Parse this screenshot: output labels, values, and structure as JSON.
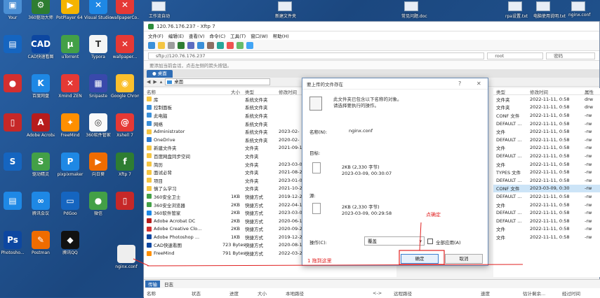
{
  "desktop": {
    "icons": [
      {
        "label": "Your",
        "color": "#4b8fd4",
        "glyph": "▣"
      },
      {
        "label": "360驱动大师",
        "color": "#2e7d32",
        "glyph": "⚙"
      },
      {
        "label": "PotPlayer 64 bit",
        "color": "#f5b400",
        "glyph": "▶"
      },
      {
        "label": "Visual Studio Code",
        "color": "#1e88e5",
        "glyph": "✕"
      },
      {
        "label": "wallpaperCo...",
        "color": "#e53935",
        "glyph": "✕"
      },
      {
        "label": "",
        "color": "#1565c0",
        "glyph": "▤"
      },
      {
        "label": "CAD快速看图",
        "color": "#0d47a1",
        "glyph": "CAD"
      },
      {
        "label": "uTorrent",
        "color": "#43a047",
        "glyph": "µ"
      },
      {
        "label": "Typora",
        "color": "#f5f5f5",
        "glyph": "T"
      },
      {
        "label": "wallpaper...",
        "color": "#e53935",
        "glyph": "✕"
      },
      {
        "label": "",
        "color": "#d32f2f",
        "glyph": "●"
      },
      {
        "label": "百度网盘",
        "color": "#1e88e5",
        "glyph": "K"
      },
      {
        "label": "Xmind ZEN",
        "color": "#e53935",
        "glyph": "✕"
      },
      {
        "label": "Snipaste",
        "color": "#3949ab",
        "glyph": "▦"
      },
      {
        "label": "Google Chrome",
        "color": "#fbc02d",
        "glyph": "◉"
      },
      {
        "label": "",
        "color": "#c62828",
        "glyph": "▯"
      },
      {
        "label": "Adobe Acrobat DC",
        "color": "#b71c1c",
        "glyph": "A"
      },
      {
        "label": "FreeMind",
        "color": "#ff8f00",
        "glyph": "✦"
      },
      {
        "label": "360软件管家",
        "color": "#fafafa",
        "glyph": "◎"
      },
      {
        "label": "Xshell 7",
        "color": "#e53935",
        "glyph": "@"
      },
      {
        "label": "",
        "color": "#1565c0",
        "glyph": "S"
      },
      {
        "label": "驱动精灵",
        "color": "#43a047",
        "glyph": "S"
      },
      {
        "label": "pixpixmaker",
        "color": "#1e88e5",
        "glyph": "P"
      },
      {
        "label": "向日葵",
        "color": "#ef6c00",
        "glyph": "▶"
      },
      {
        "label": "Xftp 7",
        "color": "#2e7d32",
        "glyph": "f"
      },
      {
        "label": "",
        "color": "#1e88e5",
        "glyph": "▤"
      },
      {
        "label": "腾讯会议",
        "color": "#1e88e5",
        "glyph": "∞"
      },
      {
        "label": "PdGoo",
        "color": "#1565c0",
        "glyph": "▭"
      },
      {
        "label": "微信",
        "color": "#43a047",
        "glyph": "●"
      },
      {
        "label": "",
        "color": "#c62828",
        "glyph": "▯"
      },
      {
        "label": "Photosho...",
        "color": "#0d47a1",
        "glyph": "Ps"
      },
      {
        "label": "Postman",
        "color": "#ef6c00",
        "glyph": "✎"
      },
      {
        "label": "腾讯QQ",
        "color": "#111111",
        "glyph": "◆"
      },
      {
        "label": "nginx.conf",
        "color": "#eeeeee",
        "glyph": ""
      }
    ],
    "top_items": [
      {
        "label": "工作流自动"
      },
      {
        "label": "新建文件夹"
      },
      {
        "label": "常见问题.doc"
      },
      {
        "label": "rpa设置.txt"
      },
      {
        "label": "电脑使用说明.txt"
      },
      {
        "label": "nginx.conf"
      }
    ]
  },
  "xftp": {
    "title": "120.76.176.237 - Xftp 7",
    "menu": [
      "文件(F)",
      "编辑(E)",
      "查看(V)",
      "命令(C)",
      "工具(T)",
      "窗口(W)",
      "帮助(H)"
    ],
    "address": "sftp://120.76.176.237",
    "remote_address": "root",
    "password_placeholder": "密码",
    "hint": "要添加当前会话，点击左侧的箭头按钮。",
    "tab_label": "● 桌面",
    "nav_path": "桌面",
    "columns": {
      "name": "名称",
      "size": "大小",
      "type": "类型",
      "date": "修改时间"
    },
    "local_files": [
      {
        "name": "库",
        "size": "",
        "type": "系统文件夹",
        "date": "",
        "color": "#f4c542"
      },
      {
        "name": "控制面板",
        "size": "",
        "type": "系统文件夹",
        "date": "",
        "color": "#3a8fd9"
      },
      {
        "name": "此电脑",
        "size": "",
        "type": "系统文件夹",
        "date": "",
        "color": "#3a8fd9"
      },
      {
        "name": "网络",
        "size": "",
        "type": "系统文件夹",
        "date": "",
        "color": "#3a8fd9"
      },
      {
        "name": "Administrator",
        "size": "",
        "type": "系统文件夹",
        "date": "2023-02-",
        "color": "#f4c542"
      },
      {
        "name": "OneDrive",
        "size": "",
        "type": "系统文件夹",
        "date": "2020-02-",
        "color": "#2b7cd3"
      },
      {
        "name": "新建文件夹",
        "size": "",
        "type": "文件夹",
        "date": "2021-09-1",
        "color": "#f4c542"
      },
      {
        "name": "百度网盘同步空间",
        "size": "",
        "type": "文件夹",
        "date": "",
        "color": "#f4c542"
      },
      {
        "name": "简历",
        "size": "",
        "type": "文件夹",
        "date": "2023-03-0",
        "color": "#f4c542"
      },
      {
        "name": "面试必背",
        "size": "",
        "type": "文件夹",
        "date": "2021-08-2",
        "color": "#f4c542"
      },
      {
        "name": "项目",
        "size": "",
        "type": "文件夹",
        "date": "2023-01-0",
        "color": "#f4c542"
      },
      {
        "name": "慎了么学习",
        "size": "",
        "type": "文件夹",
        "date": "2021-10-2",
        "color": "#f4c542"
      },
      {
        "name": "360安全卫士",
        "size": "1KB",
        "type": "快捷方式",
        "date": "2019-12-2",
        "color": "#43a047"
      },
      {
        "name": "360安全浏览器",
        "size": "2KB",
        "type": "快捷方式",
        "date": "2022-04-1",
        "color": "#43a047"
      },
      {
        "name": "360软件管家",
        "size": "2KB",
        "type": "快捷方式",
        "date": "2023-03-0",
        "color": "#1e88e5"
      },
      {
        "name": "Adobe Acrobat DC",
        "size": "2KB",
        "type": "快捷方式",
        "date": "2020-06-1",
        "color": "#b71c1c"
      },
      {
        "name": "Adobe Creative Clo...",
        "size": "2KB",
        "type": "快捷方式",
        "date": "2020-09-2",
        "color": "#d32f2f"
      },
      {
        "name": "Adobe Photoshop ...",
        "size": "1KB",
        "type": "快捷方式",
        "date": "2019-12-2",
        "color": "#0d47a1"
      },
      {
        "name": "CAD快速看图",
        "size": "723 Bytes",
        "type": "快捷方式",
        "date": "2020-08-1",
        "color": "#0d47a1"
      },
      {
        "name": "FreeMind",
        "size": "791 Bytes",
        "type": "快捷方式",
        "date": "2022-03-2",
        "color": "#ff8f00"
      }
    ],
    "remote_columns": {
      "type": "类型",
      "date": "修改时间",
      "attr": "属性"
    },
    "remote_files": [
      {
        "type": "文件夹",
        "date": "2022-11-11, 0:58",
        "attr": "drw"
      },
      {
        "type": "文件夹",
        "date": "2022-11-11, 0:58",
        "attr": "drw"
      },
      {
        "type": "CONF 文件",
        "date": "2022-11-11, 0:58",
        "attr": "-rw"
      },
      {
        "type": "DEFAULT ...",
        "date": "2022-11-11, 0:58",
        "attr": "-rw"
      },
      {
        "type": "文件",
        "date": "2022-11-11, 0:58",
        "attr": "-rw"
      },
      {
        "type": "DEFAULT ...",
        "date": "2022-11-11, 0:58",
        "attr": "-rw"
      },
      {
        "type": "文件",
        "date": "2022-11-11, 0:58",
        "attr": "-rw"
      },
      {
        "type": "DEFAULT ...",
        "date": "2022-11-11, 0:58",
        "attr": "-rw"
      },
      {
        "type": "文件",
        "date": "2022-11-11, 0:58",
        "attr": "-rw"
      },
      {
        "type": "TYPES 文件",
        "date": "2022-11-11, 0:58",
        "attr": "-rw"
      },
      {
        "type": "DEFAULT ...",
        "date": "2022-11-11, 0:58",
        "attr": "-rw"
      },
      {
        "type": "CONF 文件",
        "date": "2023-03-09, 0:30",
        "attr": "-rw"
      },
      {
        "type": "DEFAULT ...",
        "date": "2022-11-11, 0:58",
        "attr": "-rw"
      },
      {
        "type": "文件",
        "date": "2022-11-11, 0:58",
        "attr": "-rw"
      },
      {
        "type": "DEFAULT ...",
        "date": "2022-11-11, 0:58",
        "attr": "-rw"
      },
      {
        "type": "DEFAULT ...",
        "date": "2022-11-11, 0:58",
        "attr": "-rw"
      },
      {
        "type": "文件",
        "date": "2022-11-11, 0:58",
        "attr": "-rw"
      },
      {
        "type": "文件",
        "date": "2022-11-11, 0:58",
        "attr": "-rw"
      }
    ],
    "bottom_tabs": [
      "传输",
      "日志"
    ],
    "bottom_columns": [
      "名称",
      "状态",
      "进度",
      "大小",
      "本地路径",
      "<->",
      "远程路径",
      "速度",
      "估计剩余...",
      "经过时间"
    ]
  },
  "dialog": {
    "title": "要上传的文件存在",
    "question_mark": "?",
    "close_mark": "✕",
    "message_line1": "此文件夹已包含以下名称的对象。",
    "message_line2": "请选择要执行的操作。",
    "name_label": "名称(N):",
    "name_value": "nginx.conf",
    "target_label": "目标:",
    "target_size": "2KB (2,330 字节)",
    "target_date": "2023-03-09, 00:30:07",
    "source_label": "源:",
    "source_size": "2KB (2,330 字节)",
    "source_date": "2023-03-09, 00:29:58",
    "operation_label": "操作(C):",
    "operation_value": "覆盖",
    "apply_all_label": "全部应用(A)",
    "ok_label": "确定",
    "cancel_label": "取消"
  },
  "annotations": {
    "click_ok": "点确定",
    "drag_here": "1 拖到这里",
    "color": "#e02020"
  }
}
